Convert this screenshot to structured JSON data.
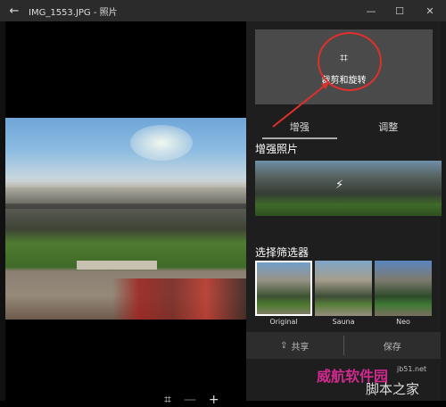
{
  "titlebar": {
    "back_icon": "←",
    "title": "IMG_1553.JPG - 照片",
    "minimize": "—",
    "maximize": "☐",
    "close": "✕"
  },
  "zoom": {
    "fit": "⌗",
    "minus": "—",
    "plus": "+"
  },
  "panel": {
    "crop_icon": "⌗",
    "crop_label": "裁剪和旋转",
    "tabs": [
      {
        "label": "增强",
        "active": true
      },
      {
        "label": "调整",
        "active": false
      }
    ],
    "enhance_title": "增强照片",
    "enhance_icon": "⚡",
    "filter_title": "选择筛选器",
    "filters": [
      {
        "label": "Original"
      },
      {
        "label": "Sauna"
      },
      {
        "label": "Neo"
      }
    ],
    "share_label": "共享",
    "share_icon": "⇪",
    "save_label": "保存"
  },
  "watermarks": {
    "site": "威航软件园",
    "url": "jb51.net",
    "alt": "脚本之家"
  },
  "colors": {
    "annotation": "#e0302c"
  }
}
